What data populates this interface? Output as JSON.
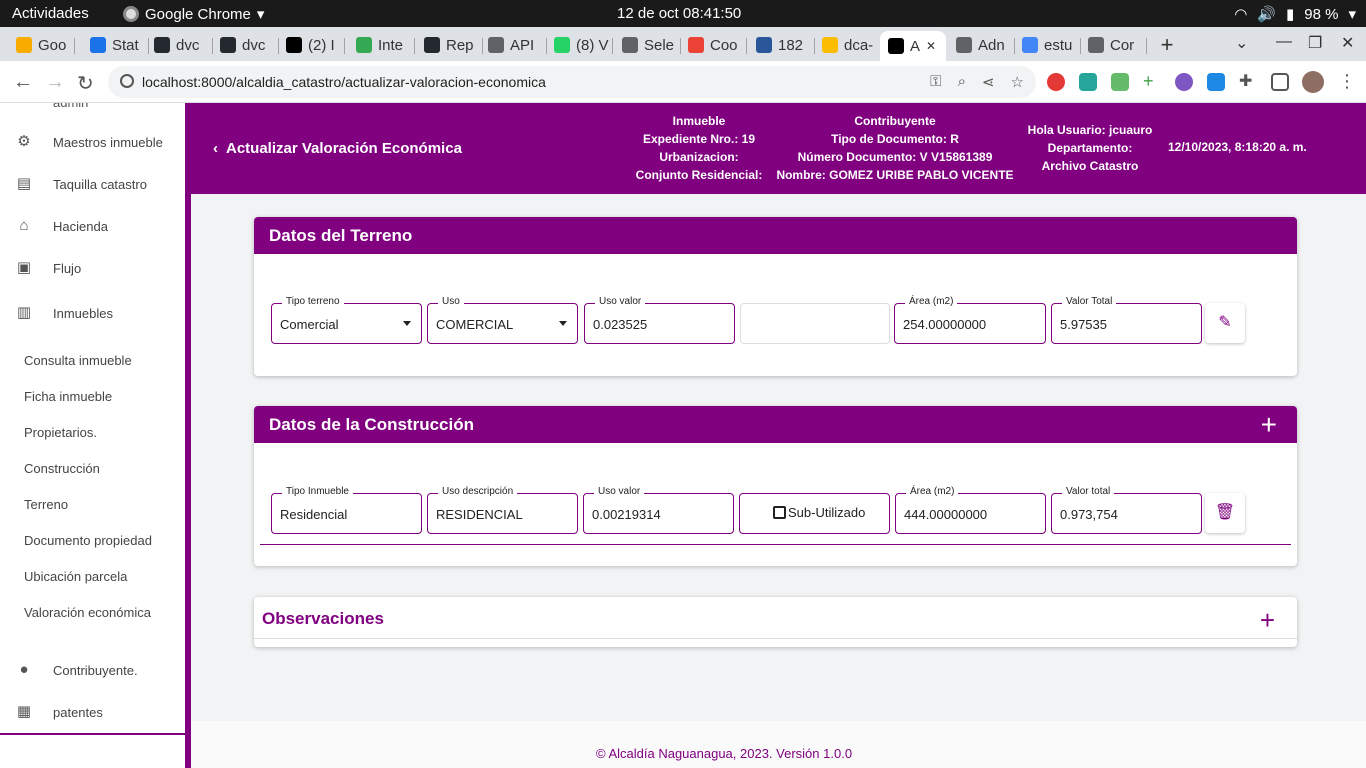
{
  "gnome": {
    "activities": "Actividades",
    "app_name": "Google Chrome",
    "clock": "12 de oct  08:41:50",
    "battery": "98 %"
  },
  "tabs": [
    {
      "label": "Goo",
      "color": "#f9ab00"
    },
    {
      "label": "Stat",
      "color": "#1a73e8"
    },
    {
      "label": "dvc",
      "color": "#24292f"
    },
    {
      "label": "dvc",
      "color": "#24292f"
    },
    {
      "label": "(2) I",
      "color": "#000000"
    },
    {
      "label": "Inte",
      "color": "#34a853"
    },
    {
      "label": "Rep",
      "color": "#24292f"
    },
    {
      "label": "API",
      "color": "#5f6368"
    },
    {
      "label": "(8) V",
      "color": "#25d366"
    },
    {
      "label": "Sele",
      "color": "#5f6368"
    },
    {
      "label": "Coo",
      "color": "#ea4335"
    },
    {
      "label": "182",
      "color": "#2b579a"
    },
    {
      "label": "dca-",
      "color": "#fbbc04"
    },
    {
      "label": "A",
      "color": "#000000"
    },
    {
      "label": "Adn",
      "color": "#5f6368"
    },
    {
      "label": "estu",
      "color": "#4285f4"
    },
    {
      "label": "Cor",
      "color": "#5f6368"
    }
  ],
  "address": {
    "url": "localhost:8000/alcaldia_catastro/actualizar-valoracion-economica"
  },
  "sidebar": {
    "partial_top": "admin",
    "items": [
      {
        "label": "Maestros inmueble",
        "icon": "settings-icon"
      },
      {
        "label": "Taquilla catastro",
        "icon": "book-icon"
      },
      {
        "label": "Hacienda",
        "icon": "bank-icon"
      },
      {
        "label": "Flujo",
        "icon": "clipboard-icon"
      },
      {
        "label": "Inmuebles",
        "icon": "building-icon"
      }
    ],
    "subitems": [
      "Consulta inmueble",
      "Ficha inmueble",
      "Propietarios.",
      "Construcción",
      "Terreno",
      "Documento propiedad",
      "Ubicación parcela",
      "Valoración económica"
    ],
    "bottom_items": [
      {
        "label": "Contribuyente.",
        "icon": "person-icon"
      },
      {
        "label": "patentes",
        "icon": "license-icon"
      }
    ]
  },
  "header": {
    "title": "Actualizar Valoración Económica",
    "inmueble": {
      "title": "Inmueble",
      "expediente": "Expediente Nro.: 19",
      "urbanizacion": "Urbanizacion:",
      "conjunto": "Conjunto Residencial:"
    },
    "contribuyente": {
      "title": "Contribuyente",
      "tipo_doc": "Tipo de Documento: R",
      "num_doc": "Número Documento: V V15861389",
      "nombre": "Nombre: GOMEZ URIBE PABLO VICENTE"
    },
    "usuario": {
      "hola": "Hola Usuario: jcuauro",
      "departamento": "Departamento:",
      "dep_value": "Archivo Catastro"
    },
    "datetime": "12/10/2023, 8:18:20 a. m."
  },
  "terreno": {
    "title": "Datos del Terreno",
    "tipo_label": "Tipo terreno",
    "tipo_value": "Comercial",
    "uso_label": "Uso",
    "uso_value": "COMERCIAL",
    "uso_valor_label": "Uso valor",
    "uso_valor_value": "0.023525",
    "area_label": "Área (m2)",
    "area_value": "254.00000000",
    "total_label": "Valor Total",
    "total_value": "5.97535"
  },
  "construccion": {
    "title": "Datos de la Construcción",
    "tipo_label": "Tipo Inmueble",
    "tipo_value": "Residencial",
    "uso_label": "Uso descripción",
    "uso_value": "RESIDENCIAL",
    "uso_valor_label": "Uso valor",
    "uso_valor_value": "0.00219314",
    "sub_label": "Sub-Utilizado",
    "area_label": "Área (m2)",
    "area_value": "444.00000000",
    "total_label": "Valor total",
    "total_value": "0.973,754"
  },
  "observaciones": {
    "title": "Observaciones"
  },
  "footer": {
    "text": "© Alcaldía Naguanagua, 2023. Versión 1.0.0"
  },
  "colors": {
    "brand": "#800080"
  }
}
